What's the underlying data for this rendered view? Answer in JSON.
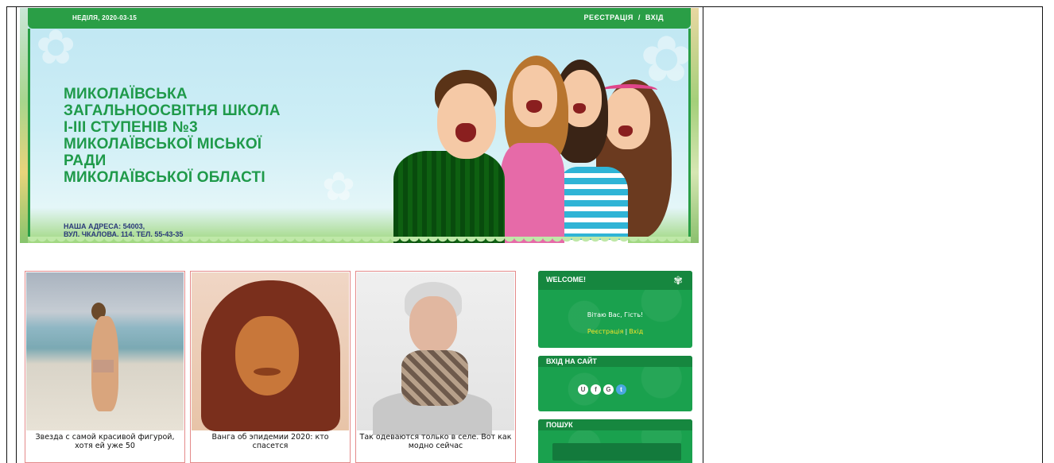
{
  "header": {
    "date": "НЕДІЛЯ, 2020-03-15",
    "register_link": "РЕЄСТРАЦІЯ",
    "separator": "/",
    "login_link": "ВХІД",
    "school_lines": [
      "МИКОЛАЇВСЬКА",
      "ЗАГАЛЬНООСВІТНЯ ШКОЛА",
      "І-ІІІ СТУПЕНІВ №3",
      "МИКОЛАЇВСЬКОЇ МІСЬКОЇ",
      "РАДИ",
      "МИКОЛАЇВСЬКОЇ ОБЛАСТІ"
    ],
    "address_lines": [
      "НАША АДРЕСА: 54003,",
      "ВУЛ. ЧКАЛОВА, 114, ТЕЛ. 55-43-35"
    ]
  },
  "cards": [
    {
      "caption": "Звезда с самой красивой фигурой, хотя ей уже 50"
    },
    {
      "caption": "Ванга об эпидемии 2020: кто спасется"
    },
    {
      "caption": "Так одеваются только в селе. Вот как модно сейчас"
    }
  ],
  "sidebar": {
    "welcome": {
      "title": "WELCOME!",
      "greeting": "Вітаю Вас, Гість!",
      "register": "Реєстрація",
      "divider": "|",
      "login": "Вхід"
    },
    "login_box": {
      "title": "ВХІД НА САЙТ",
      "socials": [
        "U",
        "f",
        "G",
        "t"
      ]
    },
    "search": {
      "title": "ПОШУК"
    }
  },
  "colors": {
    "brand_green": "#1f9a4a",
    "header_bar": "#2a9e46",
    "sidebar_bg": "#1aa14e",
    "link_yellow": "#f5e42a",
    "address_blue": "#2b3a7a"
  }
}
